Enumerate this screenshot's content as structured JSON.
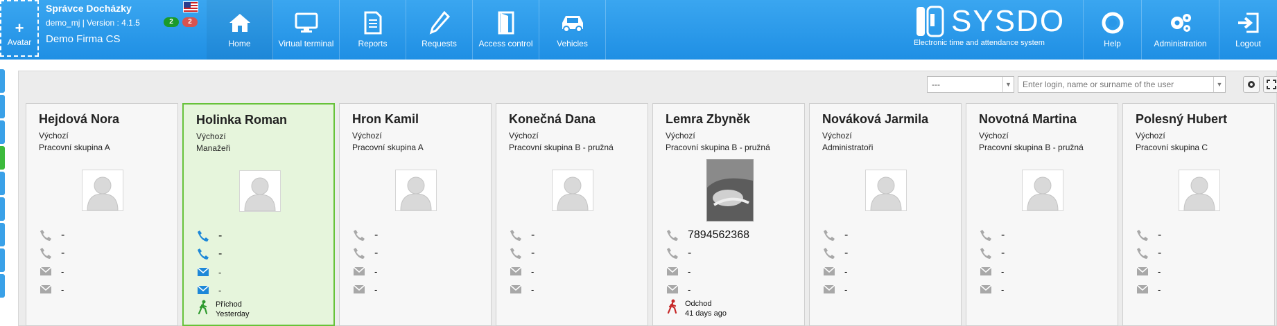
{
  "header": {
    "avatar": {
      "plus": "+",
      "label": "Avatar"
    },
    "user_name": "Správce Docházky",
    "version_line": "demo_mj | Version : 4.1.5",
    "company": "Demo Firma CS",
    "badge_green": "2",
    "badge_red": "2",
    "nav": [
      {
        "label": "Home",
        "icon": "home-icon"
      },
      {
        "label": "Virtual terminal",
        "icon": "monitor-icon"
      },
      {
        "label": "Reports",
        "icon": "document-icon"
      },
      {
        "label": "Requests",
        "icon": "pencil-icon"
      },
      {
        "label": "Access control",
        "icon": "door-icon"
      },
      {
        "label": "Vehicles",
        "icon": "car-icon"
      }
    ],
    "brand": {
      "name": "SYSDO",
      "tagline": "Electronic time and attendance system"
    },
    "right_nav": [
      {
        "label": "Help",
        "icon": "lifebuoy-icon"
      },
      {
        "label": "Administration",
        "icon": "gears-icon"
      },
      {
        "label": "Logout",
        "icon": "logout-icon"
      }
    ]
  },
  "toolbar": {
    "select_value": "---",
    "search_placeholder": "Enter login, name or surname of the user"
  },
  "cards": [
    {
      "name": "Hejdová Nora",
      "line1": "Výchozí",
      "line2": "Pracovní skupina A",
      "phone1": "-",
      "phone2": "-",
      "mail1": "-",
      "mail2": "-",
      "active": false
    },
    {
      "name": "Holinka Roman",
      "line1": "Výchozí",
      "line2": "Manažeři",
      "phone1": "-",
      "phone2": "-",
      "mail1": "-",
      "mail2": "-",
      "active": true,
      "status": {
        "label": "Příchod",
        "time": "Yesterday",
        "color": "#2e9a2e"
      }
    },
    {
      "name": "Hron Kamil",
      "line1": "Výchozí",
      "line2": "Pracovní skupina A",
      "phone1": "-",
      "phone2": "-",
      "mail1": "-",
      "mail2": "-",
      "active": false
    },
    {
      "name": "Konečná Dana",
      "line1": "Výchozí",
      "line2": "Pracovní skupina B - pružná",
      "phone1": "-",
      "phone2": "-",
      "mail1": "-",
      "mail2": "-",
      "active": false
    },
    {
      "name": "Lemra Zbyněk",
      "line1": "Výchozí",
      "line2": "Pracovní skupina B - pružná",
      "phone1": "7894562368",
      "phone2": "-",
      "mail1": "-",
      "mail2": "-",
      "active": false,
      "status": {
        "label": "Odchod",
        "time": "41 days ago",
        "color": "#c62828"
      }
    },
    {
      "name": "Nováková Jarmila",
      "line1": "Výchozí",
      "line2": "Administratoři",
      "phone1": "-",
      "phone2": "-",
      "mail1": "-",
      "mail2": "-",
      "active": false
    },
    {
      "name": "Novotná Martina",
      "line1": "Výchozí",
      "line2": "Pracovní skupina B - pružná",
      "phone1": "-",
      "phone2": "-",
      "mail1": "-",
      "mail2": "-",
      "active": false
    },
    {
      "name": "Polesný Hubert",
      "line1": "Výchozí",
      "line2": "Pracovní skupina C",
      "phone1": "-",
      "phone2": "-",
      "mail1": "-",
      "mail2": "-",
      "active": false
    }
  ]
}
